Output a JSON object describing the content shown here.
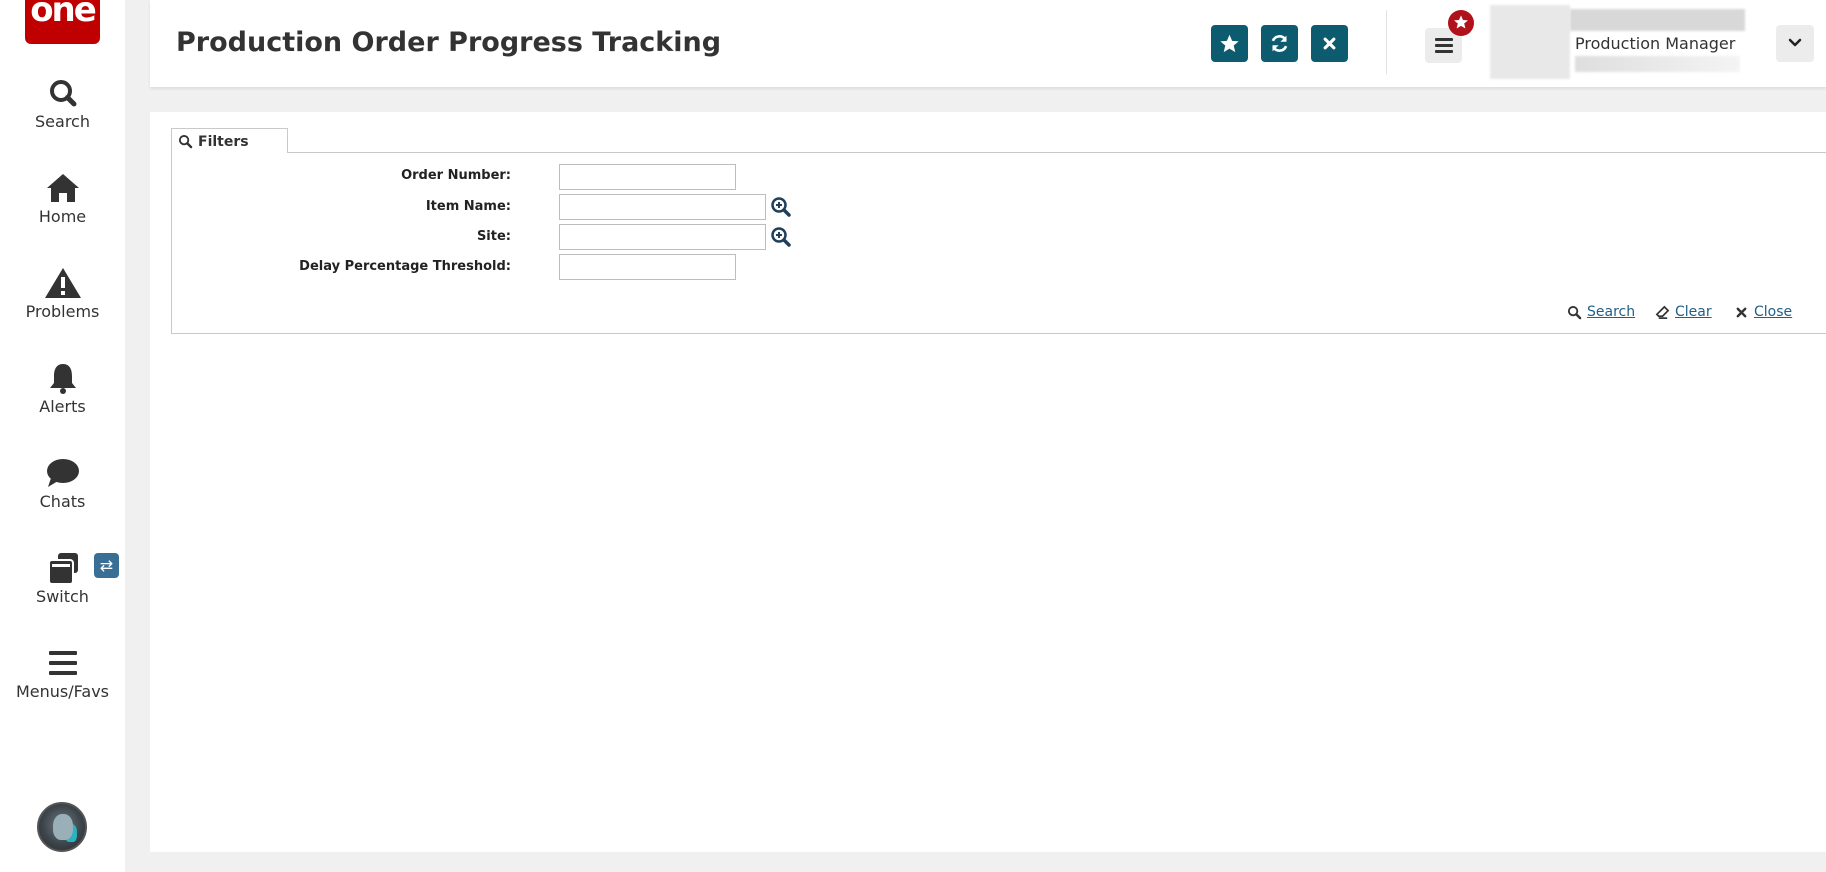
{
  "app": {
    "logo_text": "one"
  },
  "sidebar": {
    "items": [
      {
        "label": "Search",
        "icon": "search-icon"
      },
      {
        "label": "Home",
        "icon": "home-icon"
      },
      {
        "label": "Problems",
        "icon": "warning-icon"
      },
      {
        "label": "Alerts",
        "icon": "bell-icon"
      },
      {
        "label": "Chats",
        "icon": "chat-icon"
      },
      {
        "label": "Switch",
        "icon": "windows-icon"
      },
      {
        "label": "Menus/Favs",
        "icon": "menu-icon"
      }
    ],
    "switch_badge": "⇄"
  },
  "header": {
    "title": "Production Order Progress Tracking",
    "user_role": "Production Manager",
    "accent_color": "#0d5b6e",
    "badge_color": "#b0111b"
  },
  "filters": {
    "tab_label": "Filters",
    "fields": [
      {
        "label": "Order Number:",
        "value": ""
      },
      {
        "label": "Item Name:",
        "value": ""
      },
      {
        "label": "Site:",
        "value": ""
      },
      {
        "label": "Delay Percentage Threshold:",
        "value": ""
      }
    ],
    "actions": {
      "search": "Search",
      "clear": "Clear",
      "close": "Close"
    }
  }
}
